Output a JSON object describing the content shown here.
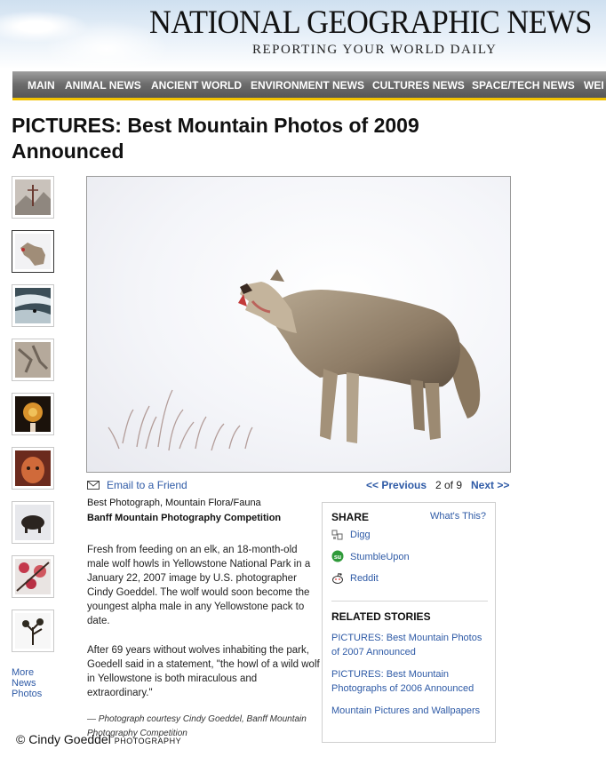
{
  "header": {
    "site_title": "NATIONAL GEOGRAPHIC NEWS",
    "tagline": "REPORTING YOUR WORLD DAILY"
  },
  "nav": {
    "items": [
      "MAIN",
      "ANIMAL NEWS",
      "ANCIENT WORLD",
      "ENVIRONMENT NEWS",
      "CULTURES NEWS",
      "SPACE/TECH NEWS",
      "WEI"
    ],
    "accent_color": "#f2c200"
  },
  "article": {
    "title": "PICTURES: Best Mountain Photos of 2009 Announced"
  },
  "thumbnails": {
    "items": [
      {
        "icon": "climber-thumbnail"
      },
      {
        "icon": "wolf-thumbnail",
        "selected": true
      },
      {
        "icon": "skier-thumbnail"
      },
      {
        "icon": "rock-thumbnail"
      },
      {
        "icon": "flower-thumbnail"
      },
      {
        "icon": "child-portrait-thumbnail"
      },
      {
        "icon": "bison-thumbnail"
      },
      {
        "icon": "blossom-thumbnail"
      },
      {
        "icon": "tree-thumbnail"
      }
    ],
    "more_link": "More News Photos"
  },
  "photo_nav": {
    "email": "Email to a Friend",
    "previous": "<< Previous",
    "count": "2 of 9",
    "next": "Next >>"
  },
  "caption": {
    "category": "Best Photograph, Mountain Flora/Fauna",
    "competition": "Banff Mountain Photography Competition",
    "paragraph1": "Fresh from feeding on an elk, an 18-month-old male wolf howls in Yellowstone National Park in a January 22, 2007 image by U.S. photographer Cindy Goeddel. The wolf would soon become the youngest alpha male in any Yellowstone pack to date.",
    "paragraph2": "After 69 years without wolves inhabiting the park, Goedell said in a statement, \"the howl of a wild wolf in Yellowstone is both miraculous and extraordinary.\"",
    "credit": "— Photograph courtesy Cindy Goeddel, Banff Mountain Photography Competition"
  },
  "share": {
    "heading": "SHARE",
    "whats_this": "What's This?",
    "services": [
      {
        "label": "Digg",
        "icon": "digg-icon"
      },
      {
        "label": "StumbleUpon",
        "icon": "stumbleupon-icon"
      },
      {
        "label": "Reddit",
        "icon": "reddit-icon"
      }
    ]
  },
  "related": {
    "heading": "RELATED STORIES",
    "stories": [
      "PICTURES: Best Mountain Photos of 2007 Announced",
      "PICTURES: Best Mountain Photographs of 2006 Announced",
      "Mountain Pictures and Wallpapers"
    ]
  },
  "watermark": {
    "name": "© Cindy Goeddel",
    "word": "PHOTOGRAPHY"
  },
  "colors": {
    "link": "#2e5aa6",
    "nav_bg": "#6d6d6d"
  }
}
